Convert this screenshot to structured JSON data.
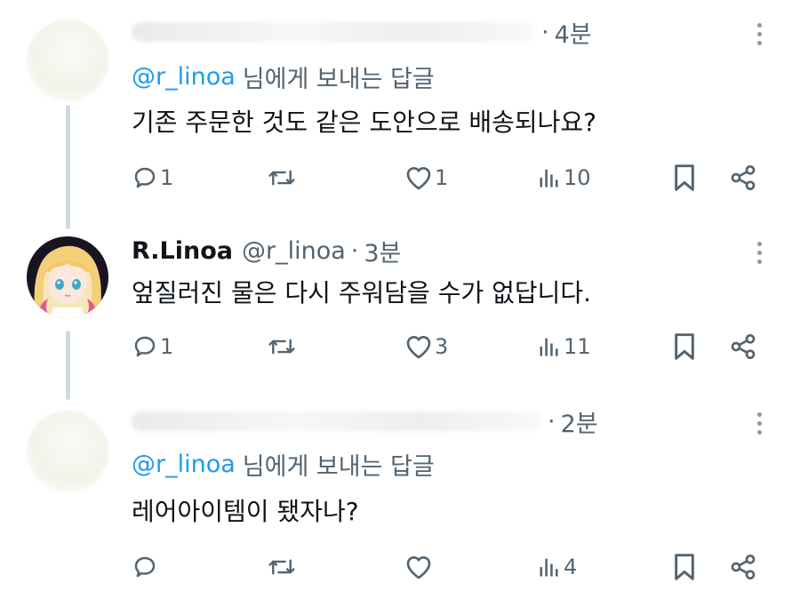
{
  "colors": {
    "accent": "#1d9bf0",
    "muted": "#536471",
    "text": "#0f1419",
    "thread_line": "#cfd9de"
  },
  "icons": {
    "reply": "reply-icon",
    "retweet": "retweet-icon",
    "like": "heart-icon",
    "views": "views-icon",
    "bookmark": "bookmark-icon",
    "share": "share-icon",
    "more": "more-icon"
  },
  "tweets": [
    {
      "time": "4분",
      "reply_mention": "@r_linoa",
      "reply_suffix": "님에게 보내는 답글",
      "text": "기존 주문한 것도 같은 도안으로 배송되나요?",
      "counts": {
        "reply": "1",
        "retweet": "",
        "like": "1",
        "views": "10"
      }
    },
    {
      "name": "R.Linoa",
      "handle": "@r_linoa",
      "time": "3분",
      "text": "엎질러진 물은 다시 주워담을 수가 없답니다.",
      "counts": {
        "reply": "1",
        "retweet": "",
        "like": "3",
        "views": "11"
      }
    },
    {
      "time": "2분",
      "reply_mention": "@r_linoa",
      "reply_suffix": "님에게 보내는 답글",
      "text": "레어아이템이 됐자나?",
      "counts": {
        "reply": "",
        "retweet": "",
        "like": "",
        "views": "4"
      }
    }
  ]
}
